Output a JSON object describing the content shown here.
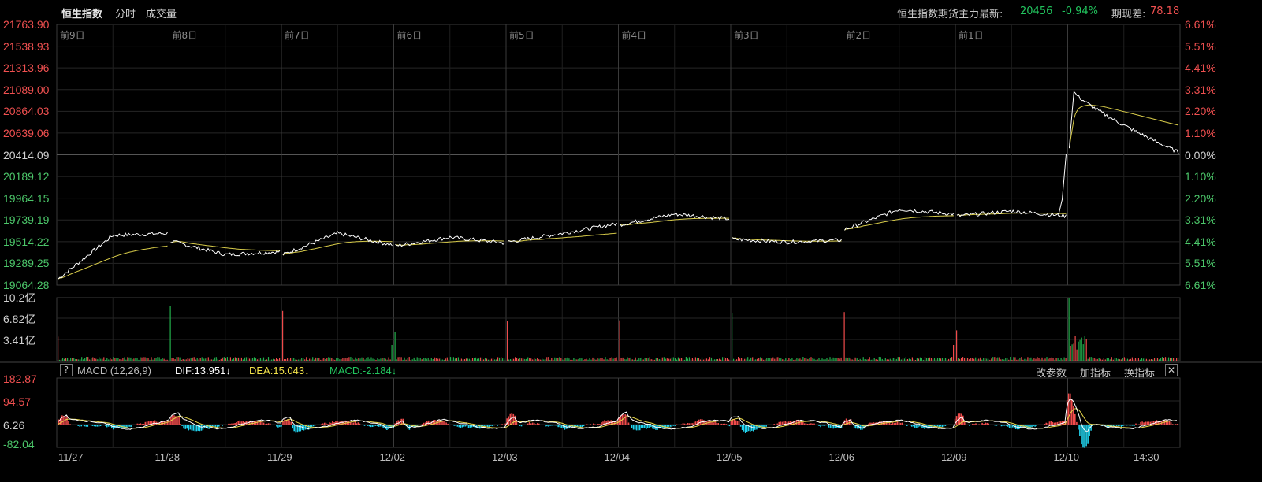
{
  "header": {
    "title": "恒生指数",
    "tab_intraday": "分时",
    "tab_volume": "成交量",
    "futures_label": "恒生指数期货主力最新:",
    "futures_price": "20456",
    "futures_change": "-0.94%",
    "basis_label": "期现差:",
    "basis_value": "78.18"
  },
  "price_axis": {
    "left_labels": [
      "21763.90",
      "21538.93",
      "21313.96",
      "21089.00",
      "20864.03",
      "20639.06",
      "20414.09",
      "20189.12",
      "19964.15",
      "19739.19",
      "19514.22",
      "19289.25",
      "19064.28"
    ],
    "right_labels": [
      "6.61%",
      "5.51%",
      "4.41%",
      "3.31%",
      "2.20%",
      "1.10%",
      "0.00%",
      "1.10%",
      "2.20%",
      "3.31%",
      "4.41%",
      "5.51%",
      "6.61%"
    ],
    "reference": 20414.09
  },
  "day_labels": [
    "前9日",
    "前8日",
    "前7日",
    "前6日",
    "前5日",
    "前4日",
    "前3日",
    "前2日",
    "前1日"
  ],
  "volume_axis": {
    "labels": [
      "10.2亿",
      "6.82亿",
      "3.41亿"
    ]
  },
  "macd": {
    "help": "?",
    "name": "MACD (12,26,9)",
    "dif": "DIF:13.951↓",
    "dea": "DEA:15.043↓",
    "macd": "MACD:-2.184↓",
    "axis_labels": [
      "182.87",
      "94.57",
      "6.26",
      "-82.04"
    ],
    "buttons": [
      "改参数",
      "加指标",
      "换指标"
    ],
    "close": "✕"
  },
  "date_labels": [
    "11/27",
    "11/28",
    "11/29",
    "12/02",
    "12/03",
    "12/04",
    "12/05",
    "12/06",
    "12/09",
    "12/10",
    "14:30"
  ],
  "colors": {
    "background": "#000000",
    "grid": "#2a2a2a",
    "up": "#f04b4b",
    "down": "#22b14c",
    "price_line": "#ffffff",
    "avg_line": "#d8cc4a",
    "dea_line": "#e8d84a",
    "macd_neg": "#22d3ee"
  },
  "chart_data": {
    "type": "line",
    "x": [
      "11/27",
      "11/28",
      "11/29",
      "12/02",
      "12/03",
      "12/04",
      "12/05",
      "12/06",
      "12/09",
      "12/10"
    ],
    "series": [
      {
        "name": "恒生指数",
        "values": [
          19300,
          19420,
          19440,
          19560,
          19520,
          19740,
          19500,
          19800,
          19760,
          20456
        ]
      }
    ],
    "ylim": [
      19064.28,
      21763.9
    ]
  }
}
